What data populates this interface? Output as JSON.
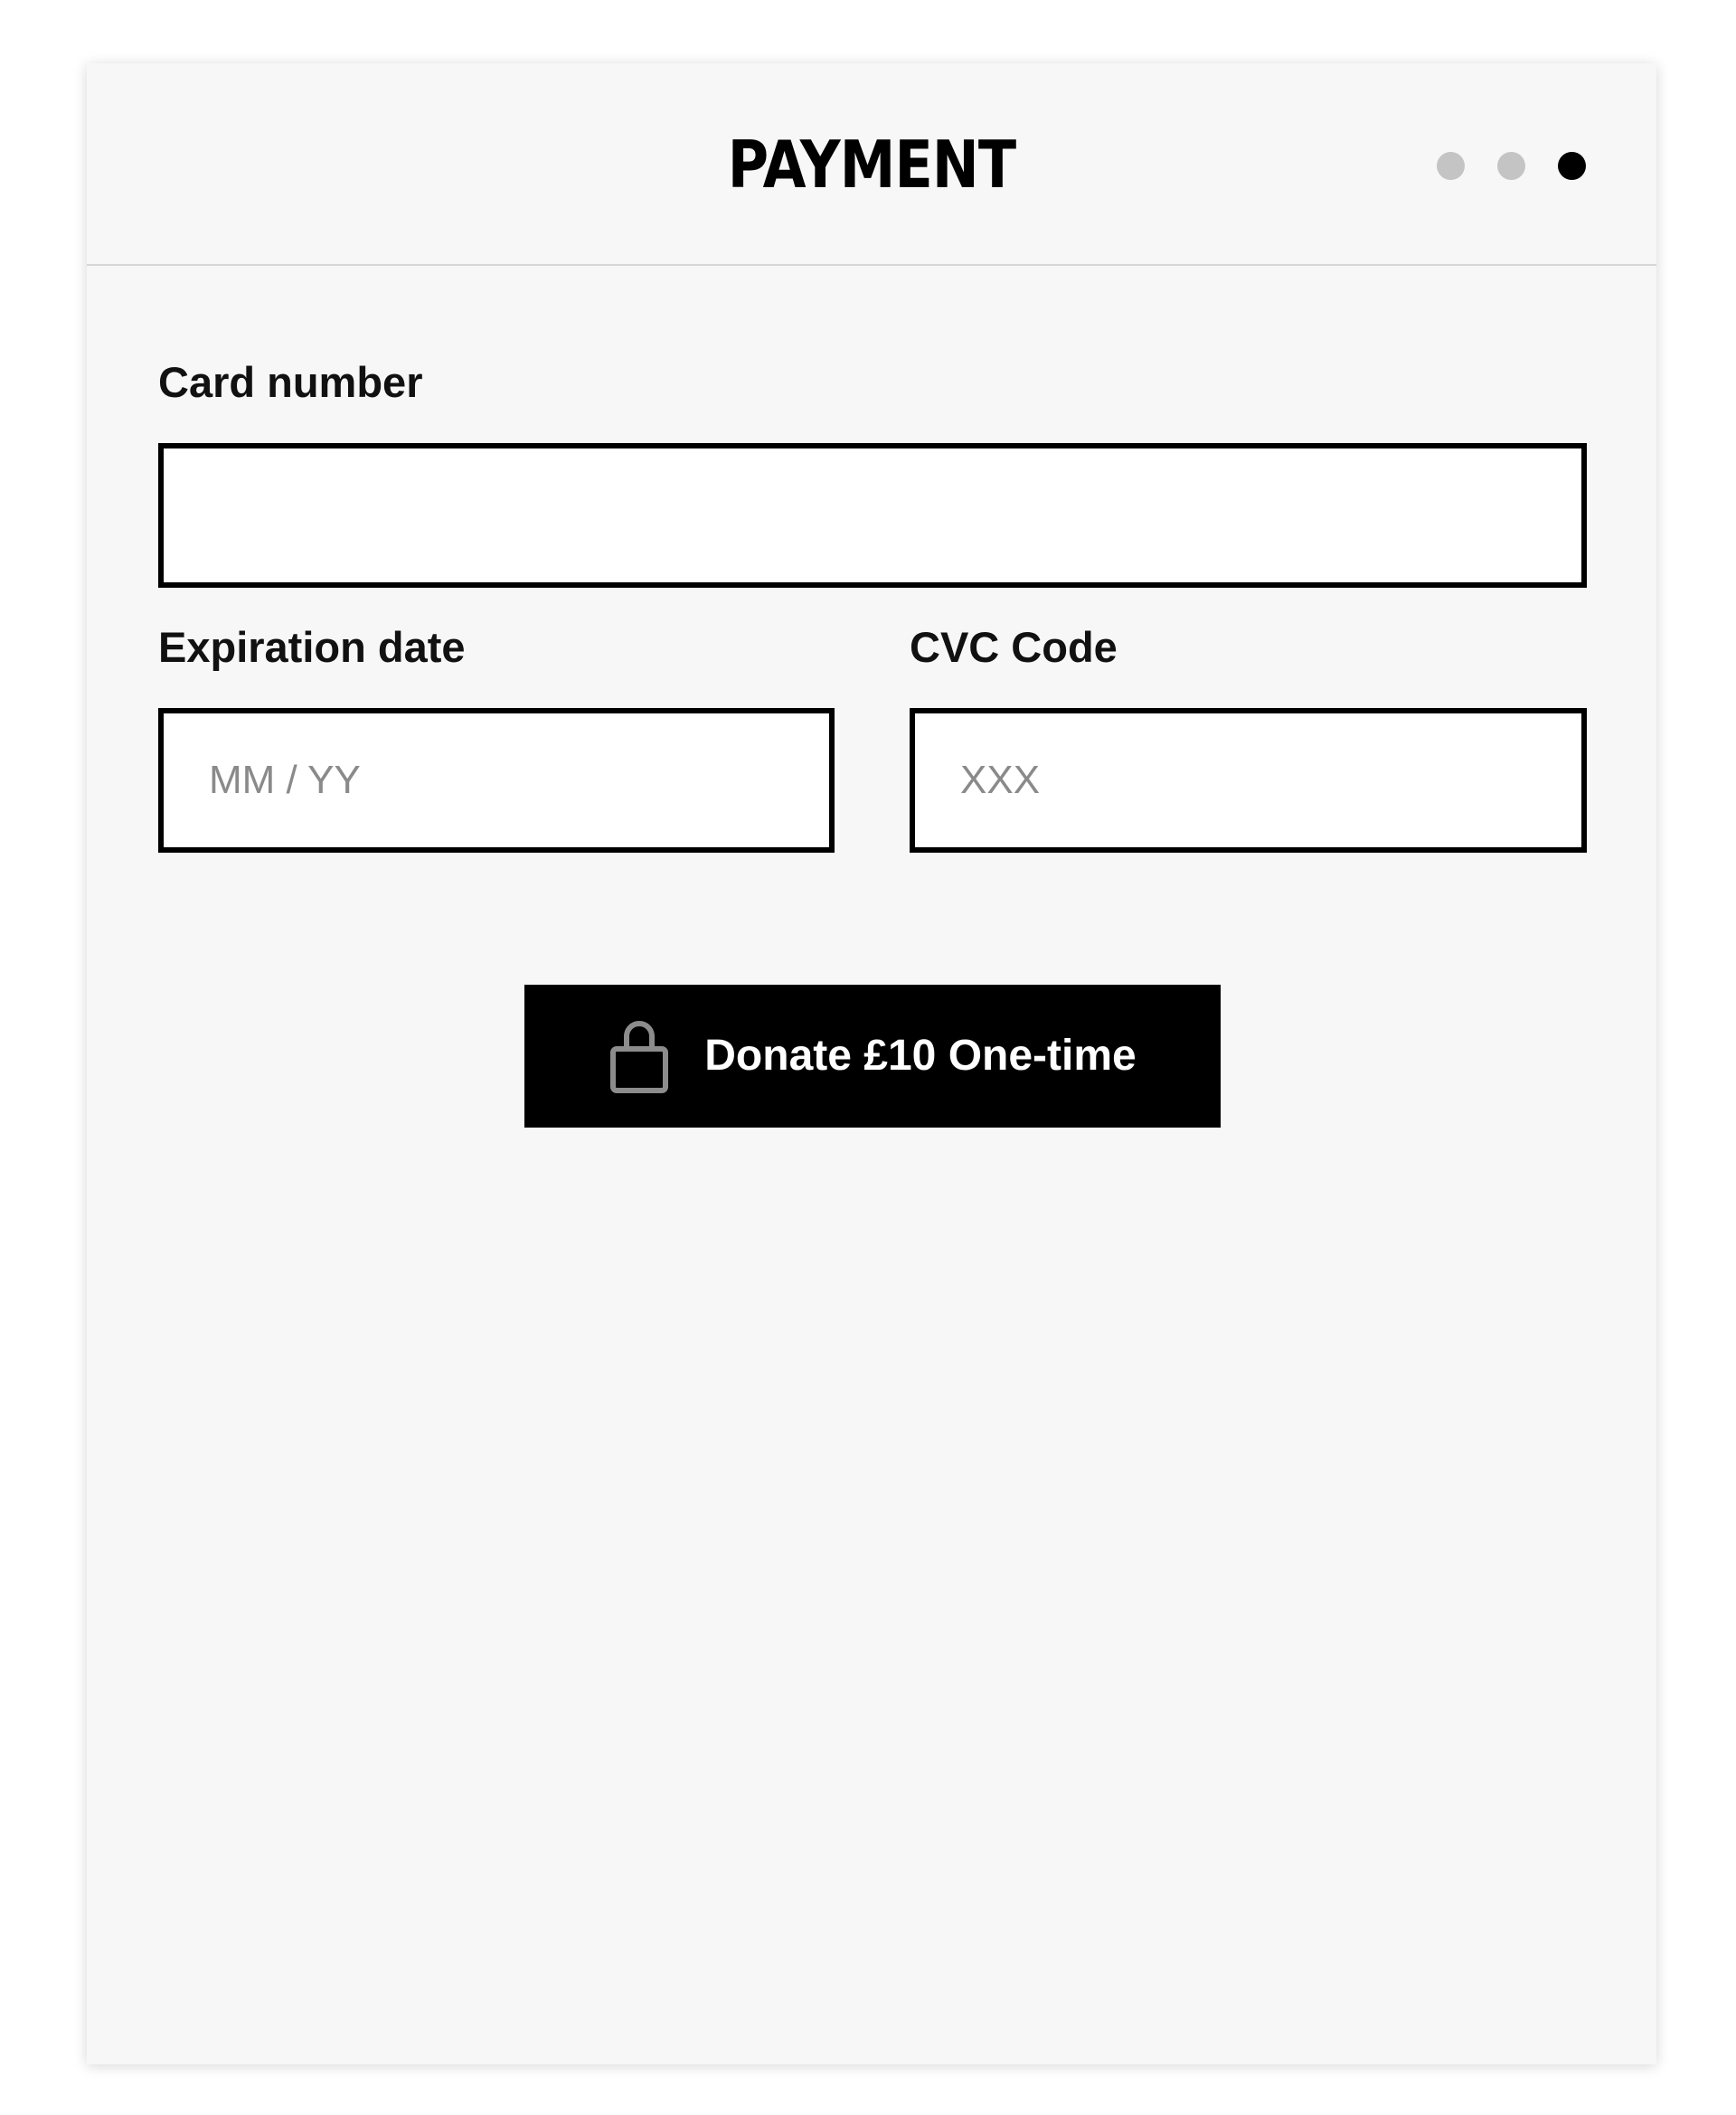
{
  "header": {
    "title": "PAYMENT",
    "steps": [
      {
        "state": "inactive"
      },
      {
        "state": "inactive"
      },
      {
        "state": "active"
      }
    ],
    "current_step": 3,
    "total_steps": 3
  },
  "form": {
    "card_number": {
      "label": "Card number",
      "value": "",
      "placeholder": ""
    },
    "expiration": {
      "label": "Expiration date",
      "value": "",
      "placeholder": "MM / YY"
    },
    "cvc": {
      "label": "CVC Code",
      "value": "",
      "placeholder": "XXX"
    }
  },
  "submit": {
    "label": "Donate £10 One-time",
    "icon": "lock-icon"
  },
  "colors": {
    "card_background": "#f7f7f7",
    "button_background": "#000000",
    "step_active": "#000000",
    "step_inactive": "#c4c4c4"
  }
}
